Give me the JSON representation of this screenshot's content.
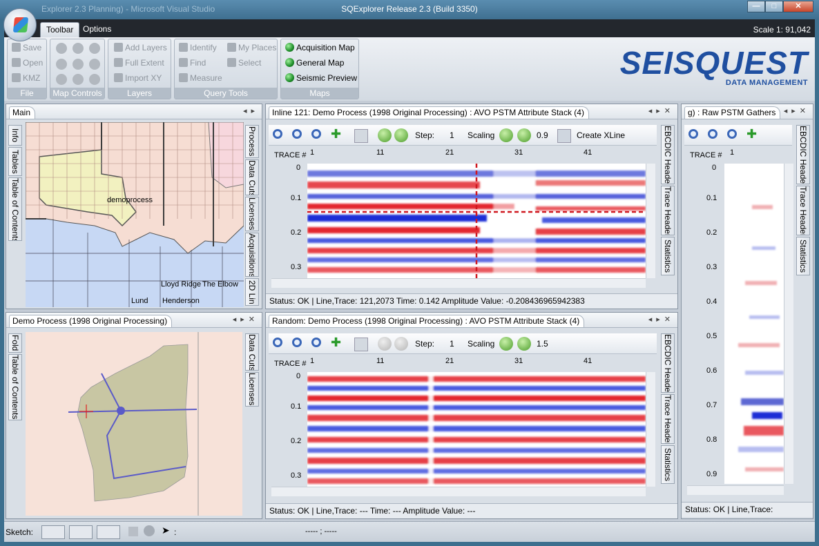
{
  "window": {
    "title": "SQExplorer Release 2.3 (Build 3350)",
    "ghost_title": "Explorer 2.3 Planning) - Microsoft Visual Studio",
    "minimize": "—",
    "maximize": "□",
    "close": "✕"
  },
  "ribbon": {
    "tabs": [
      "Toolbar",
      "Options"
    ],
    "scale": "Scale 1: 91,042",
    "groups": {
      "file": {
        "title": "File",
        "items": [
          "Save",
          "Open",
          "KMZ"
        ]
      },
      "map_controls": {
        "title": "Map Controls"
      },
      "layers": {
        "title": "Layers",
        "items": [
          "Add Layers",
          "Full Extent",
          "Import XY"
        ]
      },
      "query_tools": {
        "title": "Query Tools",
        "items": [
          "Identify",
          "My Places",
          "Find",
          "Select",
          "Measure"
        ]
      },
      "maps": {
        "title": "Maps",
        "items": [
          "Acquisition Map",
          "General Map",
          "Seismic Preview"
        ]
      }
    },
    "logo": {
      "big": "SEISQUEST",
      "small": "DATA MANAGEMENT"
    }
  },
  "main_panel": {
    "title": "Main",
    "left_tabs": [
      "Info",
      "Tables",
      "Table of Contents"
    ],
    "right_tabs": [
      "Process",
      "Data Cuts",
      "Licenses",
      "Acquisitions",
      "2D Lin"
    ],
    "map_labels": [
      "demoprocess",
      "Lloyd Ridge",
      "The Elbow",
      "Lund",
      "Henderson"
    ]
  },
  "demo_panel": {
    "title": "Demo Process (1998 Original Processing)",
    "left_tabs": [
      "Fold",
      "Table of Contents"
    ],
    "right_tabs": [
      "Data Cuts",
      "Licenses"
    ]
  },
  "inline_panel": {
    "title": "Inline 121: Demo Process (1998 Original Processing) : AVO PSTM Attribute Stack (4)",
    "step_label": "Step:",
    "step_value": "1",
    "scaling_label": "Scaling",
    "scaling_value": "0.9",
    "create_xline": "Create XLine",
    "trace_label": "TRACE #",
    "trace_ticks": [
      "1",
      "11",
      "21",
      "31",
      "41"
    ],
    "time_ticks": [
      "0",
      "0.1",
      "0.2",
      "0.3"
    ],
    "right_tabs": [
      "EBCDIC Header",
      "Trace Header",
      "Statistics"
    ],
    "status": "Status:   OK   |   Line,Trace:   121,2073   Time:   0.142   Amplitude Value:   -0.208436965942383"
  },
  "random_panel": {
    "title": "Random: Demo Process (1998 Original Processing) : AVO PSTM Attribute Stack (4)",
    "step_label": "Step:",
    "step_value": "1",
    "scaling_label": "Scaling",
    "scaling_value": "1.5",
    "trace_label": "TRACE #",
    "trace_ticks": [
      "1",
      "11",
      "21",
      "31",
      "41"
    ],
    "time_ticks": [
      "0",
      "0.1",
      "0.2",
      "0.3"
    ],
    "right_tabs": [
      "EBCDIC Header",
      "Trace Header",
      "Statistics"
    ],
    "status": "Status:   OK   |   Line,Trace:   ---   Time:   ---   Amplitude Value:   ---"
  },
  "raw_panel": {
    "title": "g) : Raw PSTM Gathers",
    "trace_label": "TRACE #",
    "trace_ticks": [
      "1"
    ],
    "time_ticks": [
      "0",
      "0.1",
      "0.2",
      "0.3",
      "0.4",
      "0.5",
      "0.6",
      "0.7",
      "0.8",
      "0.9"
    ],
    "right_tabs": [
      "EBCDIC Header",
      "Trace Header",
      "Statistics"
    ],
    "status": "Status:   OK   |   Line,Trace:"
  },
  "sketch": {
    "label": "Sketch:",
    "colon": ":",
    "coords": "----- ; -----"
  },
  "colors": {
    "accent": "#1f4fa0",
    "seismic_red": "#e0131b",
    "seismic_blue": "#1c2fd6",
    "map_basin": "#c7d8f4",
    "map_land": "#f6ddd3"
  }
}
